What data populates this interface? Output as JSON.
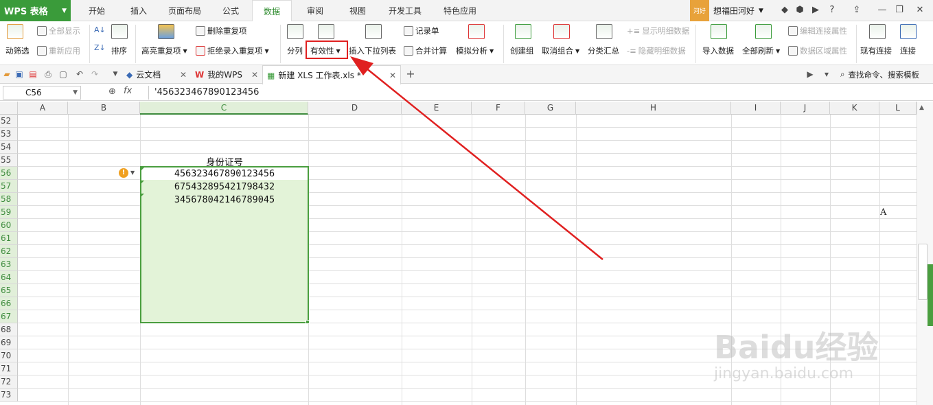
{
  "app": {
    "name": "WPS 表格",
    "user": "想福田河好",
    "avatar": "河好"
  },
  "menu_tabs": [
    "开始",
    "插入",
    "页面布局",
    "公式",
    "数据",
    "审阅",
    "视图",
    "开发工具",
    "特色应用"
  ],
  "active_tab": "数据",
  "ribbon": {
    "auto_filter": "动筛选",
    "show_all": "全部显示",
    "reapply": "重新应用",
    "sort": "排序",
    "highlight_dup": "高亮重复项",
    "remove_dup": "删除重复项",
    "reject_dup": "拒绝录入重复项",
    "split": "分列",
    "validity": "有效性",
    "insert_dropdown": "插入下拉列表",
    "record_form": "记录单",
    "merge_calc": "合并计算",
    "sim_analysis": "模拟分析",
    "create_group": "创建组",
    "ungroup": "取消组合",
    "subtotal": "分类汇总",
    "show_detail": "显示明细数据",
    "hide_detail": "隐藏明细数据",
    "import_data": "导入数据",
    "refresh_all": "全部刷新",
    "edit_conn": "编辑连接属性",
    "data_range": "数据区域属性",
    "existing_conn": "现有连接",
    "connect": "连接"
  },
  "doc_tabs": [
    {
      "label": "云文档",
      "icon": "cloud-icon"
    },
    {
      "label": "我的WPS",
      "icon": "wps-icon"
    },
    {
      "label": "新建 XLS 工作表.xls *",
      "icon": "sheet-icon"
    }
  ],
  "search_cmd": "查找命令、搜索模板",
  "formula_bar": {
    "name_box": "C56",
    "fx": "fx",
    "content": "'456323467890123456"
  },
  "columns": [
    "A",
    "B",
    "C",
    "D",
    "E",
    "F",
    "G",
    "H",
    "I",
    "J",
    "K",
    "L"
  ],
  "rows": [
    "52",
    "53",
    "54",
    "55",
    "56",
    "57",
    "58",
    "59",
    "60",
    "61",
    "62",
    "63",
    "64",
    "65",
    "66",
    "67",
    "68",
    "69",
    "70",
    "71",
    "72",
    "73"
  ],
  "cells": {
    "header": "身份证号",
    "ids": [
      "456323467890123456",
      "675432895421798432",
      "345678042146789045"
    ],
    "l59": "A"
  },
  "watermark": {
    "brand": "Baidu经验",
    "url": "jingyan.baidu.com"
  },
  "colors": {
    "accent": "#3a9b3a",
    "selection": "#e3f3d8",
    "highlight": "#e02020"
  }
}
